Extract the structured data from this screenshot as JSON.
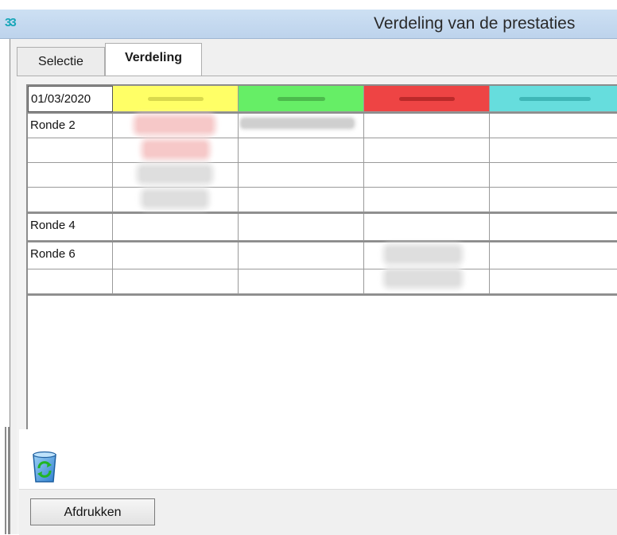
{
  "window": {
    "title": "Verdeling van de prestaties"
  },
  "tabs": [
    {
      "label": "Selectie",
      "active": false
    },
    {
      "label": "Verdeling",
      "active": true
    }
  ],
  "grid": {
    "date": "01/03/2020",
    "columns": [
      {
        "color": "#ffff66"
      },
      {
        "color": "#66ee66"
      },
      {
        "color": "#ee4444"
      },
      {
        "color": "#66dddd"
      }
    ],
    "groups": [
      {
        "label": "Ronde 2",
        "rows": 4
      },
      {
        "label": "Ronde 4",
        "rows": 1
      },
      {
        "label": "Ronde 6",
        "rows": 2
      }
    ]
  },
  "footer": {
    "refresh_icon": "refresh-icon",
    "print_label": "Afdrukken"
  }
}
